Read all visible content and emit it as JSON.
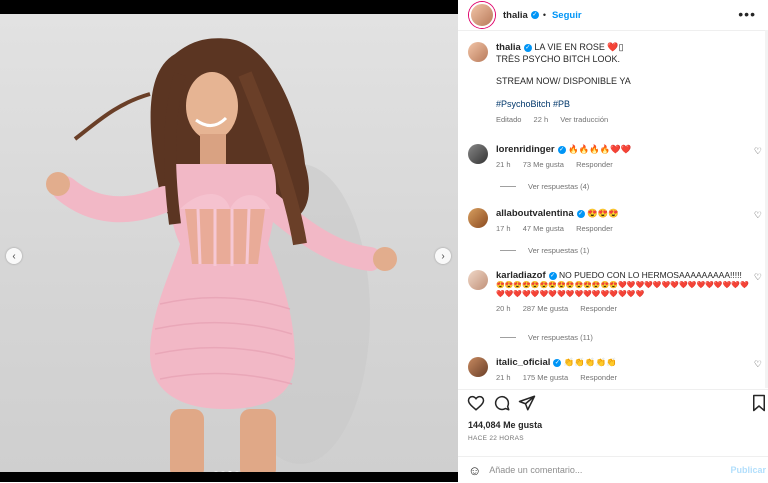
{
  "post": {
    "author": "thalia",
    "follow_label": "Seguir",
    "separator": "•",
    "more_label": "•••",
    "caption": {
      "line1": "LA VIE EN ROSE ❤️▯",
      "line2": "TRÈS PSYCHO BITCH LOOK.",
      "line3": "STREAM NOW/ DISPONIBLE YA",
      "hashtags": "#PsychoBitch #PB",
      "edited": "Editado",
      "time": "22 h",
      "translate": "Ver traducción"
    }
  },
  "comments": [
    {
      "user": "lorenridinger",
      "text": "🔥🔥🔥🔥❤️❤️",
      "time": "21 h",
      "likes": "73 Me gusta",
      "reply": "Responder",
      "replies": "Ver respuestas (4)"
    },
    {
      "user": "allaboutvalentina",
      "text": "😍😍😍",
      "time": "17 h",
      "likes": "47 Me gusta",
      "reply": "Responder",
      "replies": "Ver respuestas (1)"
    },
    {
      "user": "karladiazof",
      "text": "NO PUEDO CON LO HERMOSAAAAAAAAA!!!!!",
      "emoji": "😍😍😍😍😍😍😍😍😍😍😍😍😍😍❤️❤️❤️❤️❤️❤️❤️❤️❤️❤️❤️❤️❤️❤️❤️❤️❤️❤️❤️❤️❤️❤️❤️❤️❤️❤️❤️❤️❤️❤️❤️❤️",
      "time": "20 h",
      "likes": "287 Me gusta",
      "reply": "Responder",
      "replies": "Ver respuestas (11)"
    },
    {
      "user": "italic_oficial",
      "text": "👏👏👏👏👏",
      "time": "21 h",
      "likes": "175 Me gusta",
      "reply": "Responder"
    }
  ],
  "likes": {
    "count": "144,084",
    "label": "Me gusta"
  },
  "date": "HACE 22 HORAS",
  "composer": {
    "placeholder": "Añade un comentario...",
    "publish": "Publicar"
  },
  "icons": {
    "like": "heart-icon",
    "comment": "comment-icon",
    "share": "share-icon",
    "save": "bookmark-icon",
    "emoji": "emoji-icon"
  },
  "colors": {
    "accent": "#0095f6",
    "dress": "#f2b8c6",
    "hashtag": "#00376b"
  }
}
